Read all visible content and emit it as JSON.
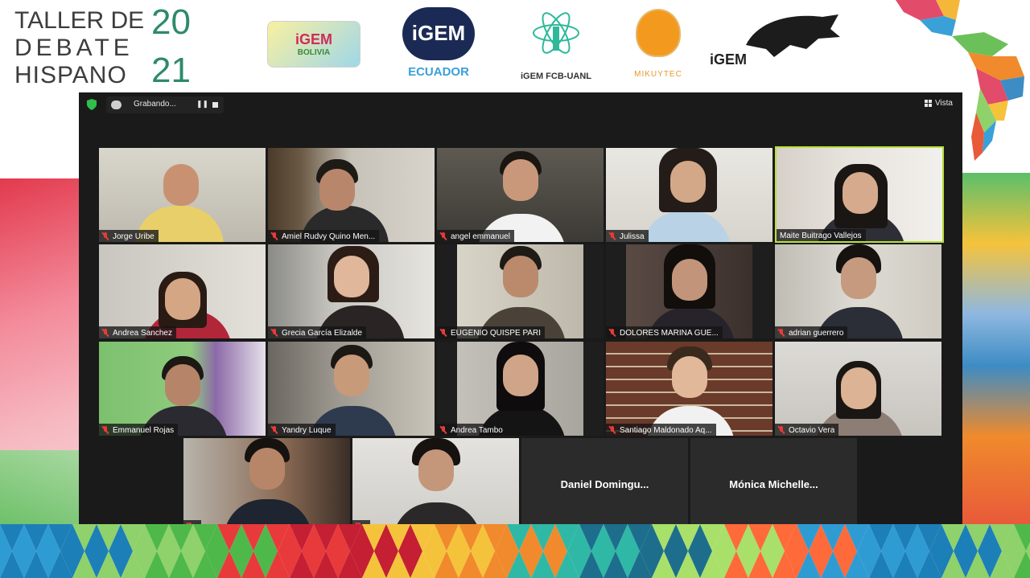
{
  "event": {
    "title_lines": [
      "TALLER DE",
      "DEBATE",
      "HISPANO"
    ],
    "year_top": "20",
    "year_bottom": "21"
  },
  "logos": [
    {
      "name": "iGEM Bolivia",
      "text": "iGEM",
      "sub": "BOLIVIA"
    },
    {
      "name": "iGEM Ecuador",
      "text": "iGEM",
      "sub": "ECUADOR"
    },
    {
      "name": "iGEM FCB-UANL",
      "text": "iGEM FCB-UANL"
    },
    {
      "name": "Mikuytec",
      "text": "MIKUYTEC"
    },
    {
      "name": "ITM iGEM",
      "text": "iGEM"
    }
  ],
  "meeting": {
    "recording_label": "Grabando...",
    "pause_icon": "pause-icon",
    "stop_icon": "stop-icon",
    "view_label": "Vista"
  },
  "participants": [
    {
      "name": "Jorge Uribe",
      "video": true
    },
    {
      "name": "Amiel Rudvy Quino Men...",
      "video": true
    },
    {
      "name": "angel emmanuel",
      "video": true
    },
    {
      "name": "Julissa",
      "video": true
    },
    {
      "name": "Maite Buitrago Vallejos",
      "video": true,
      "active_speaker": true
    },
    {
      "name": "Andrea Sanchez",
      "video": true
    },
    {
      "name": "Grecia García Elizalde",
      "video": true
    },
    {
      "name": "EUGENIO QUISPE PARI",
      "video": true
    },
    {
      "name": "DOLORES MARINA GUE...",
      "video": true
    },
    {
      "name": "adrian guerrero",
      "video": true
    },
    {
      "name": "Emmanuel Rojas",
      "video": true
    },
    {
      "name": "Yandry Luque",
      "video": true
    },
    {
      "name": "Andrea Tambo",
      "video": true
    },
    {
      "name": "Santiago Maldonado Aq...",
      "video": true
    },
    {
      "name": "Octavio Vera",
      "video": true
    },
    {
      "name": "",
      "video": true
    },
    {
      "name": "",
      "video": true
    },
    {
      "name": "Daniel  Domingu...",
      "video": false
    },
    {
      "name": "Mónica  Michelle...",
      "video": false
    }
  ],
  "colors": {
    "zoom_bg": "#1a1a1a",
    "active_border": "#b8e03a",
    "mic_muted": "#e83a3a",
    "title_text": "#3d3d3d",
    "year_text": "#2e8a6a"
  }
}
